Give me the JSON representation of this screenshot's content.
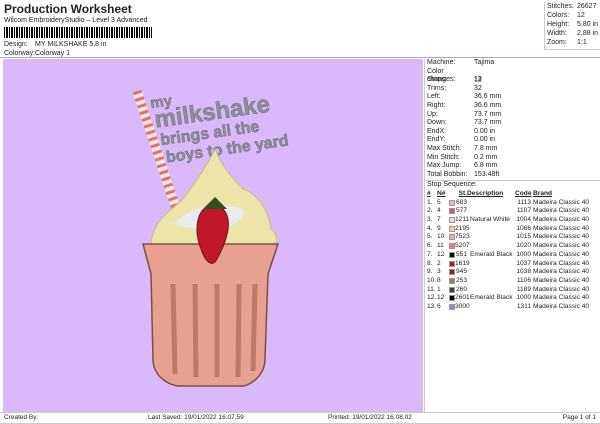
{
  "header": {
    "title": "Production Worksheet",
    "subtitle": "Wilcom EmbroideryStudio – Level 3 Advanced",
    "design_label": "Design:",
    "design_value": "MY MILKSHAKE 5,8 in",
    "colorway_label": "Colorway:",
    "colorway_value": "Colorway 1"
  },
  "stats": [
    {
      "label": "Stitches:",
      "value": "26627"
    },
    {
      "label": "Colors:",
      "value": "12"
    },
    {
      "label": "Height:",
      "value": "5.80 in"
    },
    {
      "label": "Width:",
      "value": "2.88 in"
    },
    {
      "label": "Zoom:",
      "value": "1:1"
    }
  ],
  "design_text": [
    "my",
    "milkshake",
    "brings all the",
    "boys to the yard"
  ],
  "machine_info": [
    {
      "label": "Machine:",
      "value": "Tajima"
    },
    {
      "label": "Color changes:",
      "value": "12"
    },
    {
      "label": "Stops:",
      "value": "13"
    },
    {
      "label": "Trims:",
      "value": "32"
    },
    {
      "label": "Left:",
      "value": "36.6 mm"
    },
    {
      "label": "Right:",
      "value": "36.6 mm"
    },
    {
      "label": "Up:",
      "value": "73.7 mm"
    },
    {
      "label": "Down:",
      "value": "73.7 mm"
    },
    {
      "label": "EndX:",
      "value": "0.00 in"
    },
    {
      "label": "EndY:",
      "value": "0.00 in"
    },
    {
      "label": "Max Stitch:",
      "value": "7.8 mm"
    },
    {
      "label": "Min Stitch:",
      "value": "0.2 mm"
    },
    {
      "label": "Max Jump:",
      "value": "6.8 mm"
    },
    {
      "label": "Total Bobbin:",
      "value": "153.48ft"
    }
  ],
  "stop_sequence": {
    "title": "Stop Sequence:",
    "columns": [
      "#",
      "N#",
      "St.",
      "Description",
      "Code",
      "Brand"
    ],
    "rows": [
      {
        "n": "1.",
        "needle": "5",
        "color": "#f0b4b4",
        "st": "683",
        "desc": "",
        "code": "1113",
        "brand": "Madeira Classic 40"
      },
      {
        "n": "2.",
        "needle": "4",
        "color": "#e0506c",
        "st": "577",
        "desc": "",
        "code": "1107",
        "brand": "Madeira Classic 40"
      },
      {
        "n": "3.",
        "needle": "7",
        "color": "#dedede",
        "st": "1211",
        "desc": "Natural White",
        "code": "1004",
        "brand": "Madeira Classic 40"
      },
      {
        "n": "4.",
        "needle": "9",
        "color": "#f0d094",
        "st": "2195",
        "desc": "",
        "code": "1066",
        "brand": "Madeira Classic 40"
      },
      {
        "n": "5.",
        "needle": "10",
        "color": "#f0a8a8",
        "st": "7523",
        "desc": "",
        "code": "1015",
        "brand": "Madeira Classic 40"
      },
      {
        "n": "6.",
        "needle": "11",
        "color": "#f08070",
        "st": "5207",
        "desc": "",
        "code": "1020",
        "brand": "Madeira Classic 40"
      },
      {
        "n": "7.",
        "needle": "12",
        "color": "#000000",
        "st": "551",
        "desc": "Emerald Black",
        "code": "1000",
        "brand": "Madeira Classic 40"
      },
      {
        "n": "8.",
        "needle": "2",
        "color": "#c01020",
        "st": "1619",
        "desc": "",
        "code": "1037",
        "brand": "Madeira Classic 40"
      },
      {
        "n": "9.",
        "needle": "3",
        "color": "#902028",
        "st": "945",
        "desc": "",
        "code": "1038",
        "brand": "Madeira Classic 40"
      },
      {
        "n": "10.",
        "needle": "8",
        "color": "#948450",
        "st": "253",
        "desc": "",
        "code": "1106",
        "brand": "Madeira Classic 40"
      },
      {
        "n": "11.",
        "needle": "1",
        "color": "#305024",
        "st": "260",
        "desc": "",
        "code": "1189",
        "brand": "Madeira Classic 40"
      },
      {
        "n": "12.",
        "needle": "12",
        "color": "#000000",
        "st": "2601",
        "desc": "Emerald Black",
        "code": "1000",
        "brand": "Madeira Classic 40"
      },
      {
        "n": "13.",
        "needle": "6",
        "color": "#8c8cc8",
        "st": "3000",
        "desc": "",
        "code": "1311",
        "brand": "Madeira Classic 40"
      }
    ]
  },
  "footer": {
    "created_by": "Created By:",
    "last_saved": "Last Saved: 19/01/2022 16.07.59",
    "printed": "Printed: 19/01/2022 16.08.02",
    "page": "Page 1 of 1"
  }
}
